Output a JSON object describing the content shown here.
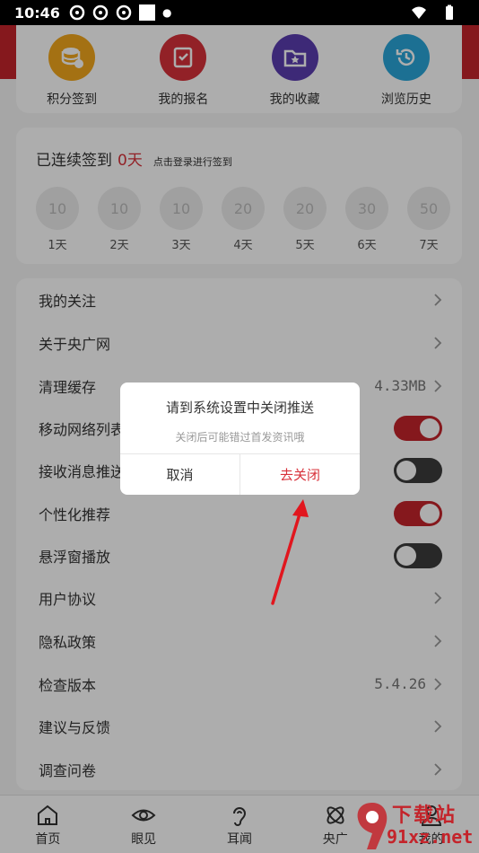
{
  "status_bar": {
    "time": "10:46"
  },
  "quick_actions": [
    {
      "label": "积分签到",
      "icon": "coin-stack-icon",
      "color": "#f2a71d"
    },
    {
      "label": "我的报名",
      "icon": "book-check-icon",
      "color": "#d8313a"
    },
    {
      "label": "我的收藏",
      "icon": "folder-star-icon",
      "color": "#5b3db0"
    },
    {
      "label": "浏览历史",
      "icon": "history-icon",
      "color": "#2aa6d9"
    }
  ],
  "sign_in": {
    "title": "已连续签到",
    "days_count": "0天",
    "hint": "点击登录进行签到",
    "days": [
      {
        "points": "10",
        "label": "1天"
      },
      {
        "points": "10",
        "label": "2天"
      },
      {
        "points": "10",
        "label": "3天"
      },
      {
        "points": "20",
        "label": "4天"
      },
      {
        "points": "20",
        "label": "5天"
      },
      {
        "points": "30",
        "label": "6天"
      },
      {
        "points": "50",
        "label": "7天"
      }
    ]
  },
  "settings": {
    "items": [
      {
        "label": "我的关注"
      },
      {
        "label": "关于央广网"
      },
      {
        "label": "清理缓存",
        "value": "4.33MB"
      },
      {
        "label": "移动网络列表",
        "toggle": true
      },
      {
        "label": "接收消息推送",
        "toggle": false
      },
      {
        "label": "个性化推荐",
        "toggle": true
      },
      {
        "label": "悬浮窗播放",
        "toggle": false
      },
      {
        "label": "用户协议"
      },
      {
        "label": "隐私政策"
      },
      {
        "label": "检查版本",
        "value": "5.4.26"
      },
      {
        "label": "建议与反馈"
      },
      {
        "label": "调查问卷"
      }
    ]
  },
  "dialog": {
    "title": "请到系统设置中关闭推送",
    "message": "关闭后可能错过首发资讯哦",
    "cancel_label": "取消",
    "confirm_label": "去关闭"
  },
  "tabbar": {
    "tabs": [
      {
        "label": "首页",
        "icon": "home-icon"
      },
      {
        "label": "眼见",
        "icon": "eye-icon"
      },
      {
        "label": "耳闻",
        "icon": "ear-icon"
      },
      {
        "label": "央广",
        "icon": "orbit-icon"
      },
      {
        "label": "我的",
        "icon": "user-icon"
      }
    ]
  },
  "watermark": {
    "top": "下载站",
    "bottom": "91xz.net"
  },
  "colors": {
    "accent": "#c4242b",
    "toggle_off": "#3b3b3b"
  }
}
